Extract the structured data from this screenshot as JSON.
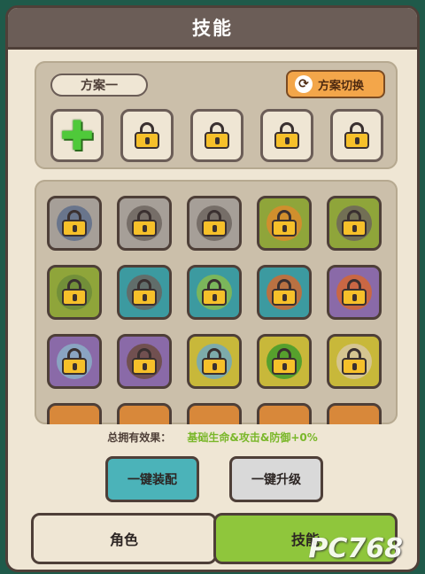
{
  "title": "技能",
  "plan": {
    "name": "方案一",
    "switch_label": "方案切换",
    "slots": [
      "add",
      "locked",
      "locked",
      "locked",
      "locked"
    ]
  },
  "skills": {
    "tiles": [
      {
        "bg": "#a69f98",
        "art": "#5a6a8a"
      },
      {
        "bg": "#a69f98",
        "art": "#6a625c"
      },
      {
        "bg": "#a69f98",
        "art": "#6a625c"
      },
      {
        "bg": "#8fa53a",
        "art": "#e08a2a"
      },
      {
        "bg": "#8fa53a",
        "art": "#6a625c"
      },
      {
        "bg": "#8fa53a",
        "art": "#6a8a3a"
      },
      {
        "bg": "#3c9aa0",
        "art": "#6a625c"
      },
      {
        "bg": "#3c9aa0",
        "art": "#8bbd4a"
      },
      {
        "bg": "#3c9aa0",
        "art": "#d8662a"
      },
      {
        "bg": "#8a6aa8",
        "art": "#d8662a"
      },
      {
        "bg": "#8a6aa8",
        "art": "#8ab3c8"
      },
      {
        "bg": "#8a6aa8",
        "art": "#6a4a3a"
      },
      {
        "bg": "#c8b83a",
        "art": "#6aa8c8"
      },
      {
        "bg": "#c8b83a",
        "art": "#3a9a2a"
      },
      {
        "bg": "#c8b83a",
        "art": "#d8c8a8"
      }
    ]
  },
  "effect": {
    "label": "总拥有效果：",
    "value": "基础生命&攻击&防御+0%"
  },
  "buttons": {
    "equip": "一键装配",
    "upgrade": "一键升级"
  },
  "tabs": {
    "role": "角色",
    "skill": "技能"
  },
  "watermark": "PC768"
}
